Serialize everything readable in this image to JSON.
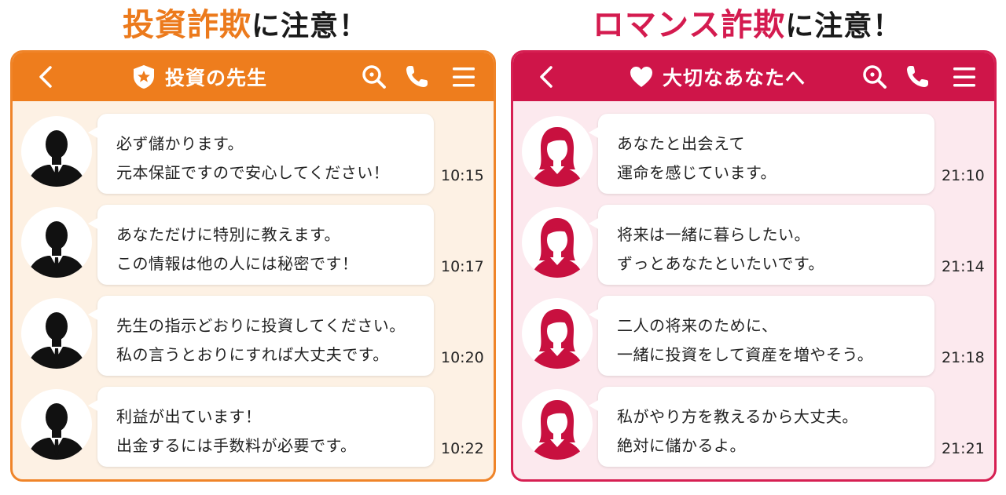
{
  "left": {
    "heading_em": "投資詐欺",
    "heading_suffix": "に注意！",
    "title": "投資の先生",
    "messages": [
      {
        "line1": "必ず儲かります。",
        "line2": "元本保証ですので安心してください！",
        "time": "10:15"
      },
      {
        "line1": "あなただけに特別に教えます。",
        "line2": "この情報は他の人には秘密です！",
        "time": "10:17"
      },
      {
        "line1": "先生の指示どおりに投資してください。",
        "line2": "私の言うとおりにすれば大丈夫です。",
        "time": "10:20"
      },
      {
        "line1": "利益が出ています！",
        "line2": "出金するには手数料が必要です。",
        "time": "10:22"
      }
    ]
  },
  "right": {
    "heading_em": "ロマンス詐欺",
    "heading_suffix": "に注意！",
    "title": "大切なあなたへ",
    "messages": [
      {
        "line1": "あなたと出会えて",
        "line2": "運命を感じています。",
        "time": "21:10"
      },
      {
        "line1": "将来は一緒に暮らしたい。",
        "line2": "ずっとあなたといたいです。",
        "time": "21:14"
      },
      {
        "line1": "二人の将来のために、",
        "line2": "一緒に投資をして資産を増やそう。",
        "time": "21:18"
      },
      {
        "line1": "私がやり方を教えるから大丈夫。",
        "line2": "絶対に儲かるよ。",
        "time": "21:21"
      }
    ]
  },
  "colors": {
    "investment_accent": "#ee7d1d",
    "investment_bg": "#fdf1e4",
    "romance_accent": "#cf1549",
    "romance_bg": "#fce9ee"
  },
  "icons": {
    "header": [
      "back-arrow-icon",
      "search-icon",
      "phone-icon",
      "menu-icon"
    ],
    "left_title": "shield-star-icon",
    "right_title": "heart-icon",
    "left_avatar": "businessman-silhouette-icon",
    "right_avatar": "woman-avatar-icon"
  }
}
